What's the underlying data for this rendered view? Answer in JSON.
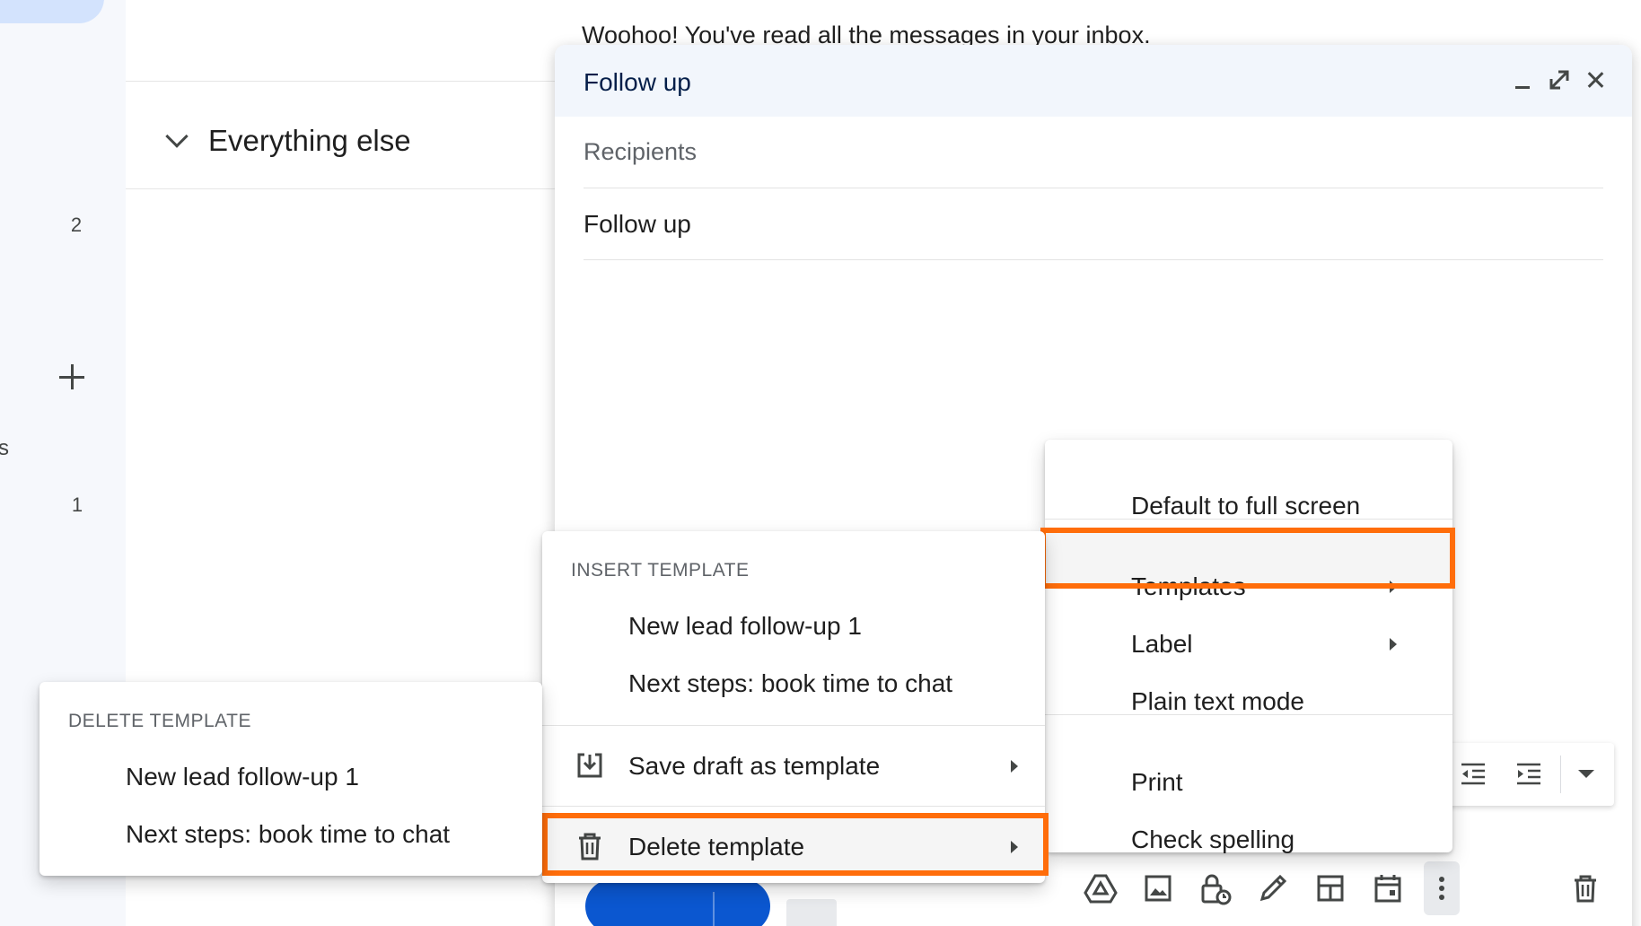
{
  "inbox": {
    "empty_message": "Woohoo! You've read all the messages in your inbox.",
    "section_title": "Everything else"
  },
  "sidebar": {
    "counts": [
      "2",
      "1"
    ],
    "truncated_label": "s"
  },
  "compose": {
    "title": "Follow up",
    "recipients_placeholder": "Recipients",
    "subject": "Follow up"
  },
  "more_menu": {
    "items": [
      "Default to full screen",
      "Templates",
      "Label",
      "Plain text mode",
      "Print",
      "Check spelling"
    ]
  },
  "templates_menu": {
    "section_label": "INSERT TEMPLATE",
    "insert_items": [
      "New lead follow-up 1",
      "Next steps: book time to chat"
    ],
    "save_label": "Save draft as template",
    "delete_label": "Delete template"
  },
  "delete_menu": {
    "section_label": "DELETE TEMPLATE",
    "items": [
      "New lead follow-up 1",
      "Next steps: book time to chat"
    ]
  },
  "colors": {
    "highlight": "#ff6d0a",
    "send_button": "#0b57d0",
    "header_bg": "#f2f6fc"
  }
}
